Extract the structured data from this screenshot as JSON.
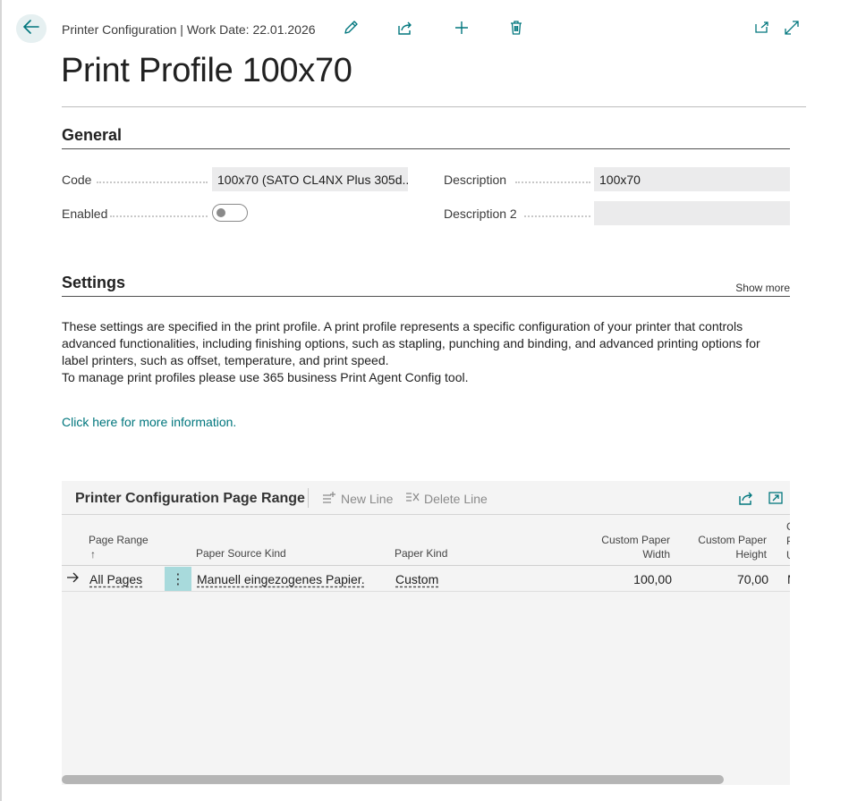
{
  "header": {
    "breadcrumb": "Printer Configuration | Work Date: 22.01.2026",
    "title": "Print Profile 100x70",
    "icons": [
      "back-arrow-icon",
      "edit-icon",
      "share-icon",
      "add-icon",
      "delete-icon",
      "open-new-window-icon",
      "expand-icon"
    ]
  },
  "general": {
    "title": "General",
    "code_label": "Code",
    "code_value": "100x70 (SATO CL4NX Plus 305d...",
    "enabled_label": "Enabled",
    "enabled_value": false,
    "description_label": "Description",
    "description_value": "100x70",
    "description2_label": "Description 2",
    "description2_value": ""
  },
  "settings": {
    "title": "Settings",
    "show_more": "Show more",
    "text_line1": "These settings are specified in the print profile. A print profile represents a specific configuration of your printer that controls advanced functionalities, including finishing options, such as stapling, punching and binding, and advanced printing options for label printers, such as offset, temperature, and print speed.",
    "text_line2": "To manage print profiles please use 365 business Print Agent Config tool.",
    "link": "Click here for more information."
  },
  "subpage": {
    "title": "Printer Configuration Page Range",
    "new_line": "New Line",
    "delete_line": "Delete Line",
    "columns": {
      "page_range": "Page Range",
      "sort_arrow": "↑",
      "paper_source_kind": "Paper Source Kind",
      "paper_kind": "Paper Kind",
      "custom_width_1": "Custom Paper",
      "custom_width_2": "Width",
      "custom_height_1": "Custom Paper",
      "custom_height_2": "Height",
      "next_col_1": "C",
      "next_col_2": "P",
      "next_col_3": "U"
    },
    "rows": [
      {
        "page_range": "All Pages",
        "paper_source_kind": "Manuell eingezogenes Papier.",
        "paper_kind": "Custom",
        "custom_width": "100,00",
        "custom_height": "70,00",
        "next_col": "M"
      }
    ]
  },
  "colors": {
    "accent": "#00767d",
    "row_selected": "#a8dadc",
    "field_bg": "#ebebec"
  }
}
